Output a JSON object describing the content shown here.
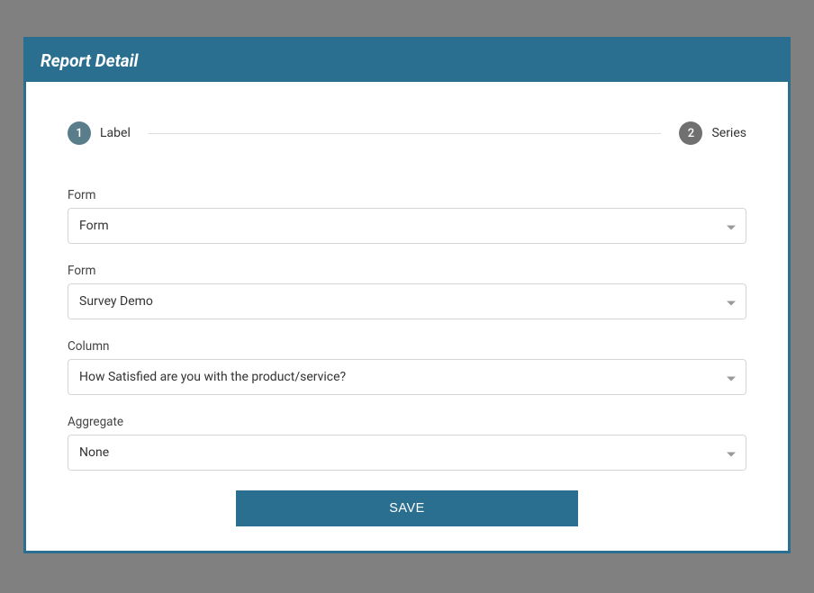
{
  "header": {
    "title": "Report Detail"
  },
  "stepper": {
    "steps": [
      {
        "num": "1",
        "label": "Label"
      },
      {
        "num": "2",
        "label": "Series"
      }
    ]
  },
  "fields": {
    "form1": {
      "label": "Form",
      "value": "Form"
    },
    "form2": {
      "label": "Form",
      "value": "Survey Demo"
    },
    "column": {
      "label": "Column",
      "value": "How Satisfied are you with the product/service?"
    },
    "aggregate": {
      "label": "Aggregate",
      "value": "None"
    }
  },
  "actions": {
    "save": "SAVE"
  }
}
